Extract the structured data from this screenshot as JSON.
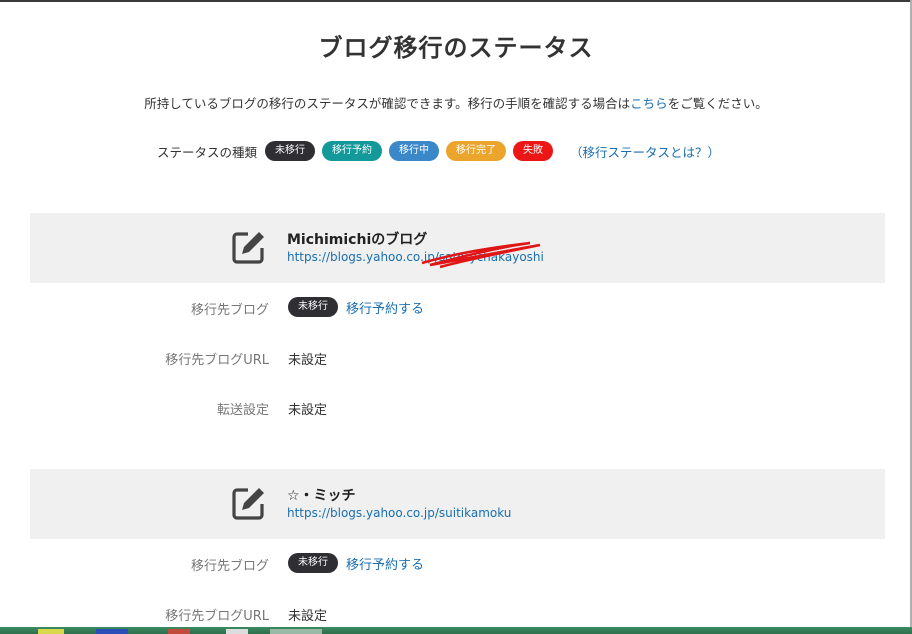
{
  "page": {
    "title": "ブログ移行のステータス",
    "intro_text": "所持しているブログの移行のステータスが確認できます。移行の手順を確認する場合は",
    "intro_link": "こちら",
    "intro_suffix": "をご覧ください。"
  },
  "legend": {
    "label": "ステータスの種類",
    "badges": [
      "未移行",
      "移行予約",
      "移行中",
      "移行完了",
      "失敗"
    ],
    "help_link": "（移行ステータスとは？）"
  },
  "blogs": [
    {
      "name": "Michimichiのブログ",
      "url": "https://blogs.yahoo.co.jp/satorychakayoshi",
      "rows": {
        "target_blog_label": "移行先ブログ",
        "status_badge": "未移行",
        "action_link": "移行予約する",
        "target_url_label": "移行先ブログURL",
        "target_url_value": "未設定",
        "forwarding_label": "転送設定",
        "forwarding_value": "未設定"
      }
    },
    {
      "name": "☆・ミッチ",
      "url": "https://blogs.yahoo.co.jp/suitikamoku",
      "rows": {
        "target_blog_label": "移行先ブログ",
        "status_badge": "未移行",
        "action_link": "移行予約する",
        "target_url_label": "移行先ブログURL",
        "target_url_value": "未設定"
      }
    }
  ],
  "colors": {
    "link": "#1a6fb0",
    "badge_unmigrated": "#2e2e33",
    "badge_reserved": "#13999a",
    "badge_migrating": "#3a87c9",
    "badge_done": "#eba52c",
    "badge_failed": "#ed1616"
  }
}
